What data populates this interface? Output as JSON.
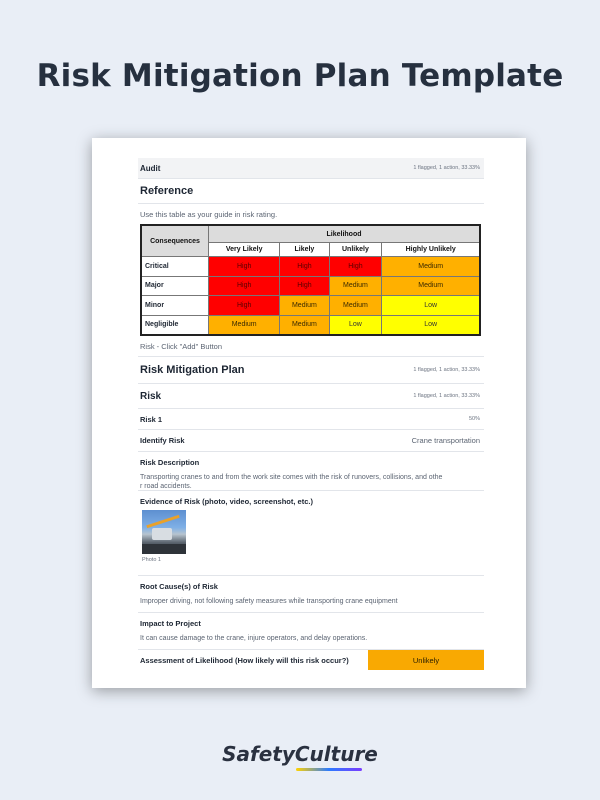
{
  "page": {
    "title": "Risk Mitigation Plan Template"
  },
  "audit": {
    "label": "Audit",
    "meta": "1 flagged, 1 action, 33.33%"
  },
  "reference": {
    "title": "Reference",
    "guide": "Use this table as your guide in risk rating.",
    "table": {
      "consequences_header": "Consequences",
      "likelihood_header": "Likelihood",
      "columns": [
        "Very Likely",
        "Likely",
        "Unlikely",
        "Highly Unlikely"
      ],
      "rows": [
        {
          "label": "Critical",
          "cells": [
            "High",
            "High",
            "High",
            "Medium"
          ]
        },
        {
          "label": "Major",
          "cells": [
            "High",
            "High",
            "Medium",
            "Medium"
          ]
        },
        {
          "label": "Minor",
          "cells": [
            "High",
            "Medium",
            "Medium",
            "Low"
          ]
        },
        {
          "label": "Negligible",
          "cells": [
            "Medium",
            "Medium",
            "Low",
            "Low"
          ]
        }
      ]
    },
    "add_hint": "Risk - Click \"Add\" Button"
  },
  "plan": {
    "title": "Risk Mitigation Plan",
    "meta": "1 flagged, 1 action, 33.33%"
  },
  "risk_section": {
    "title": "Risk",
    "meta": "1 flagged, 1 action, 33.33%"
  },
  "risk1": {
    "label": "Risk 1",
    "percent": "50%"
  },
  "identify": {
    "label": "Identify Risk",
    "value": "Crane transportation"
  },
  "description": {
    "label": "Risk Description",
    "text_line1": "Transporting cranes to and from the work site comes with the risk of runovers, collisions, and othe",
    "text_line2": "r road accidents."
  },
  "evidence": {
    "label": "Evidence of Risk (photo, video, screenshot, etc.)",
    "photo_caption": "Photo 1"
  },
  "root_cause": {
    "label": "Root Cause(s) of Risk",
    "text": "Improper driving, not following safety measures while transporting crane equipment"
  },
  "impact": {
    "label": "Impact to Project",
    "text": "It can cause damage to the crane, injure operators, and delay operations."
  },
  "assessment": {
    "label": "Assessment of Likelihood (How likely will this risk occur?)",
    "value": "Unlikely"
  },
  "colors": {
    "high": "#ff0000",
    "medium": "#ffb000",
    "low": "#ffff00",
    "answer": "#f9a902"
  },
  "brand": {
    "logo_text": "SafetyCulture"
  }
}
